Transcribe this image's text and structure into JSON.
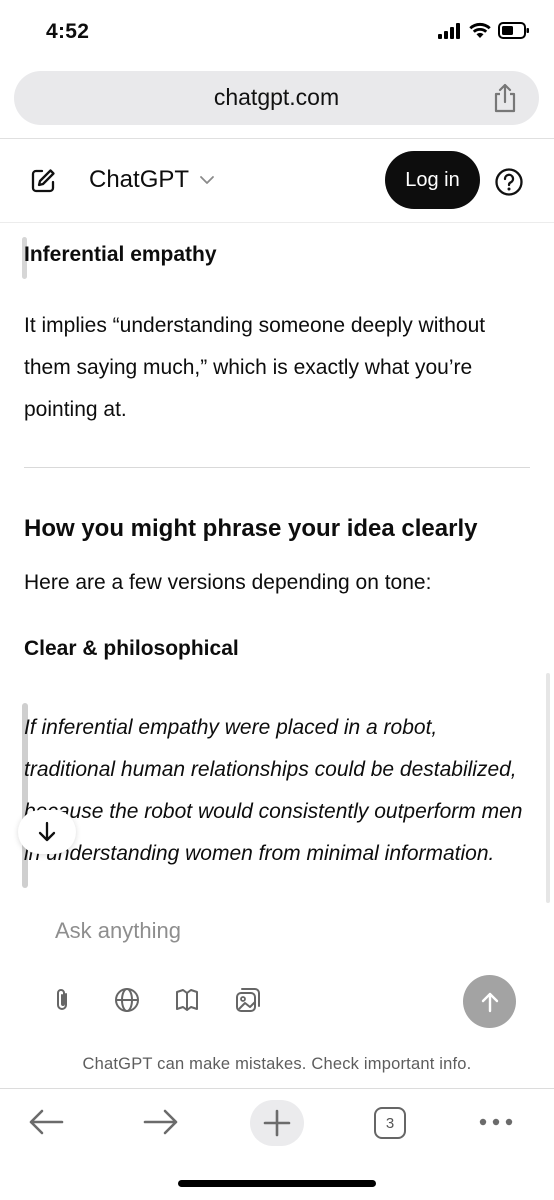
{
  "status_bar": {
    "time": "4:52"
  },
  "browser": {
    "url": "chatgpt.com",
    "tab_count": "3"
  },
  "header": {
    "title": "ChatGPT",
    "login_label": "Log in"
  },
  "content": {
    "section1_heading": "Inferential empathy",
    "section1_text": "It implies “understanding someone deeply without them saying much,” which is exactly what you’re pointing at.",
    "section2_heading": "How you might phrase your idea clearly",
    "section2_intro": "Here are a few versions depending on tone:",
    "section3_heading": "Clear & philosophical",
    "quote": "If inferential empathy were placed in a robot, traditional human relationships could be destabilized, because the robot would consistently outperform men in understanding women from minimal information."
  },
  "composer": {
    "placeholder": "Ask anything",
    "disclaimer": "ChatGPT can make mistakes. Check important info."
  },
  "icons": [
    "signal-icon",
    "wifi-icon",
    "battery-icon",
    "share-icon",
    "new-chat-icon",
    "chevron-down-icon",
    "help-icon",
    "arrow-down-icon",
    "attach-icon",
    "globe-icon",
    "book-icon",
    "image-icon",
    "arrow-up-icon",
    "back-icon",
    "forward-icon",
    "plus-icon",
    "tabs-icon",
    "more-icon"
  ]
}
